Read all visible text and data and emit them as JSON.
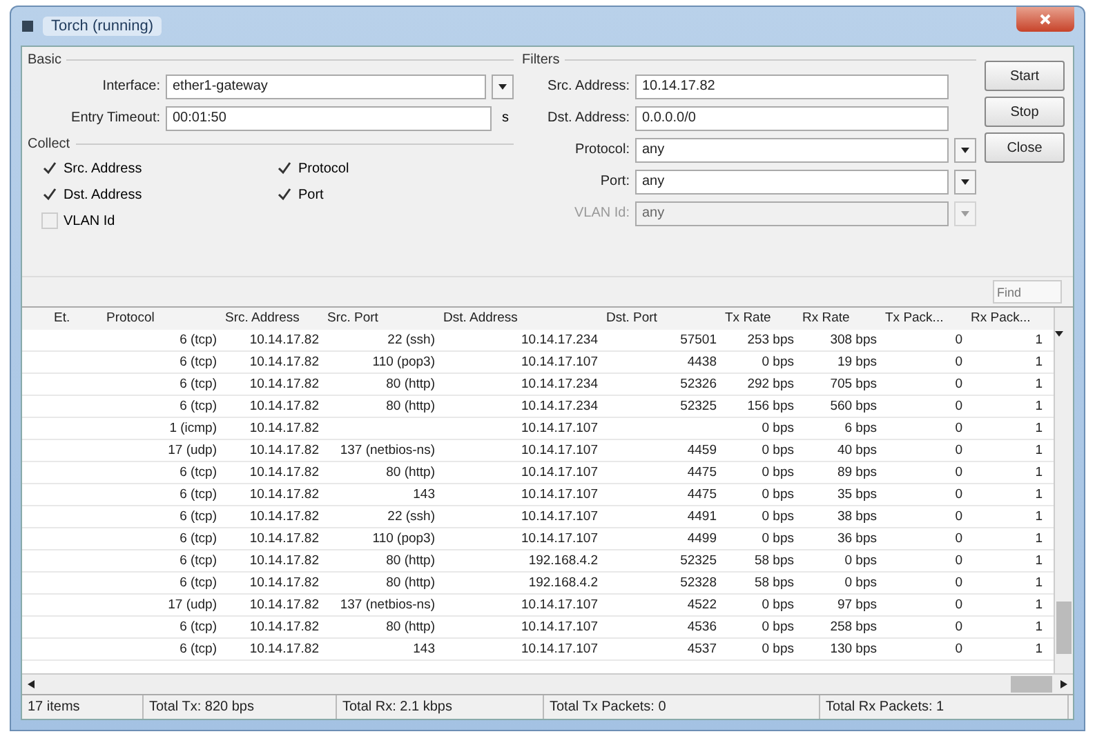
{
  "window": {
    "title": "Torch (running)"
  },
  "basic": {
    "legend": "Basic",
    "interface_label": "Interface:",
    "interface": "ether1-gateway",
    "timeout_label": "Entry Timeout:",
    "timeout": "00:01:50",
    "timeout_unit": "s"
  },
  "collect": {
    "legend": "Collect",
    "items": [
      {
        "label": "Src. Address",
        "checked": true
      },
      {
        "label": "Protocol",
        "checked": true
      },
      {
        "label": "Dst. Address",
        "checked": true
      },
      {
        "label": "Port",
        "checked": true
      },
      {
        "label": "VLAN Id",
        "checked": false
      }
    ]
  },
  "filters": {
    "legend": "Filters",
    "fields": [
      {
        "label": "Src. Address:",
        "value": "10.14.17.82",
        "kind": "text",
        "disabled": false
      },
      {
        "label": "Dst. Address:",
        "value": "0.0.0.0/0",
        "kind": "text",
        "disabled": false
      },
      {
        "label": "Protocol:",
        "value": "any",
        "kind": "select",
        "disabled": false
      },
      {
        "label": "Port:",
        "value": "any",
        "kind": "select",
        "disabled": false
      },
      {
        "label": "VLAN Id:",
        "value": "any",
        "kind": "select",
        "disabled": true
      }
    ]
  },
  "buttons": [
    "Start",
    "Stop",
    "Close"
  ],
  "find": {
    "placeholder": "Find"
  },
  "table": {
    "columns": [
      "Et.",
      "Protocol",
      "Src. Address",
      "Src. Port",
      "Dst. Address",
      "Dst. Port",
      "Tx Rate",
      "Rx Rate",
      "Tx Pack...",
      "Rx Pack..."
    ],
    "rows": [
      [
        "",
        "6 (tcp)",
        "10.14.17.82",
        "22 (ssh)",
        "10.14.17.234",
        "57501",
        "253 bps",
        "308 bps",
        "0",
        "1"
      ],
      [
        "",
        "6 (tcp)",
        "10.14.17.82",
        "110 (pop3)",
        "10.14.17.107",
        "4438",
        "0 bps",
        "19 bps",
        "0",
        "1"
      ],
      [
        "",
        "6 (tcp)",
        "10.14.17.82",
        "80 (http)",
        "10.14.17.234",
        "52326",
        "292 bps",
        "705 bps",
        "0",
        "1"
      ],
      [
        "",
        "6 (tcp)",
        "10.14.17.82",
        "80 (http)",
        "10.14.17.234",
        "52325",
        "156 bps",
        "560 bps",
        "0",
        "1"
      ],
      [
        "",
        "1 (icmp)",
        "10.14.17.82",
        "",
        "10.14.17.107",
        "",
        "0 bps",
        "6 bps",
        "0",
        "1"
      ],
      [
        "",
        "17 (udp)",
        "10.14.17.82",
        "137 (netbios-ns)",
        "10.14.17.107",
        "4459",
        "0 bps",
        "40 bps",
        "0",
        "1"
      ],
      [
        "",
        "6 (tcp)",
        "10.14.17.82",
        "80 (http)",
        "10.14.17.107",
        "4475",
        "0 bps",
        "89 bps",
        "0",
        "1"
      ],
      [
        "",
        "6 (tcp)",
        "10.14.17.82",
        "143",
        "10.14.17.107",
        "4475",
        "0 bps",
        "35 bps",
        "0",
        "1"
      ],
      [
        "",
        "6 (tcp)",
        "10.14.17.82",
        "22 (ssh)",
        "10.14.17.107",
        "4491",
        "0 bps",
        "38 bps",
        "0",
        "1"
      ],
      [
        "",
        "6 (tcp)",
        "10.14.17.82",
        "110 (pop3)",
        "10.14.17.107",
        "4499",
        "0 bps",
        "36 bps",
        "0",
        "1"
      ],
      [
        "",
        "6 (tcp)",
        "10.14.17.82",
        "80 (http)",
        "192.168.4.2",
        "52325",
        "58 bps",
        "0 bps",
        "0",
        "1"
      ],
      [
        "",
        "6 (tcp)",
        "10.14.17.82",
        "80 (http)",
        "192.168.4.2",
        "52328",
        "58 bps",
        "0 bps",
        "0",
        "1"
      ],
      [
        "",
        "17 (udp)",
        "10.14.17.82",
        "137 (netbios-ns)",
        "10.14.17.107",
        "4522",
        "0 bps",
        "97 bps",
        "0",
        "1"
      ],
      [
        "",
        "6 (tcp)",
        "10.14.17.82",
        "80 (http)",
        "10.14.17.107",
        "4536",
        "0 bps",
        "258 bps",
        "0",
        "1"
      ],
      [
        "",
        "6 (tcp)",
        "10.14.17.82",
        "143",
        "10.14.17.107",
        "4537",
        "0 bps",
        "130 bps",
        "0",
        "1"
      ]
    ]
  },
  "status_bar": [
    "17 items",
    "Total Tx: 820 bps",
    "Total Rx: 2.1 kbps",
    "Total Tx Packets: 0",
    "Total Rx Packets: 1"
  ]
}
